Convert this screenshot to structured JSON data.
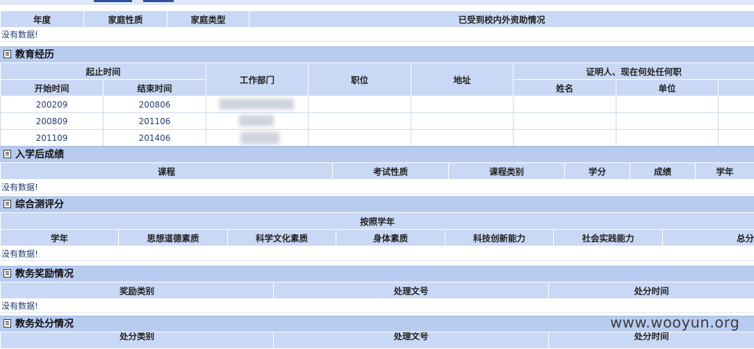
{
  "family_aid": {
    "headers": [
      "年度",
      "家庭性质",
      "家庭类型",
      "已受到校内外资助情况"
    ],
    "empty_text": "没有数据!"
  },
  "education": {
    "title": "教育经历",
    "headers": {
      "period": "起止时间",
      "start": "开始时间",
      "end": "结束时间",
      "dept": "工作部门",
      "position": "职位",
      "address": "地址",
      "witness": "证明人、现在何处任何职",
      "name": "姓名",
      "unit": "单位"
    },
    "rows": [
      {
        "start": "200209",
        "end": "200806"
      },
      {
        "start": "200809",
        "end": "201106"
      },
      {
        "start": "201109",
        "end": "201406"
      }
    ]
  },
  "grades": {
    "title": "入学后成绩",
    "headers": [
      "课程",
      "考试性质",
      "课程类别",
      "学分",
      "成绩",
      "学年"
    ],
    "empty_text": "没有数据!"
  },
  "evaluation": {
    "title": "综合测评分",
    "group_header": "按照学年",
    "headers": [
      "学年",
      "思想道德素质",
      "科学文化素质",
      "身体素质",
      "科技创新能力",
      "社会实践能力",
      "总分"
    ],
    "empty_text": "没有数据!"
  },
  "awards": {
    "title": "教务奖励情况",
    "headers": [
      "奖励类别",
      "处理文号",
      "处分时间"
    ],
    "empty_text": "没有数据!"
  },
  "penalties": {
    "title": "教务处分情况",
    "headers": [
      "处分类别",
      "处理文号",
      "处分时间"
    ]
  },
  "watermark": "www.wooyun.org"
}
